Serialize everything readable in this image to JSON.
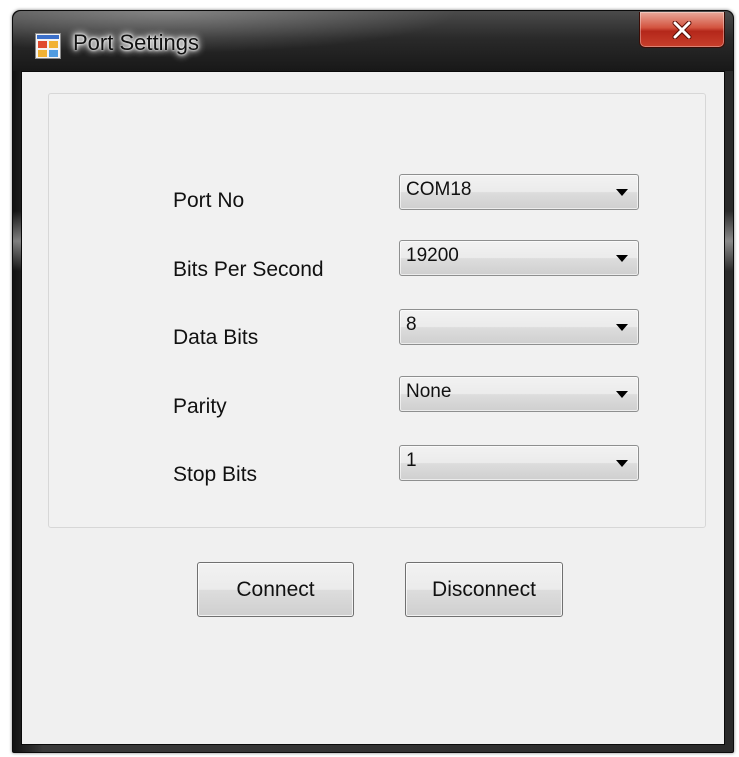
{
  "window": {
    "title": "Port Settings",
    "close_icon": "close-x-icon",
    "app_icon": "application-icon"
  },
  "form": {
    "fields": [
      {
        "label": "Port No",
        "value": "COM18"
      },
      {
        "label": "Bits Per Second",
        "value": "19200"
      },
      {
        "label": "Data Bits",
        "value": "8"
      },
      {
        "label": "Parity",
        "value": "None"
      },
      {
        "label": "Stop Bits",
        "value": "1"
      }
    ]
  },
  "buttons": {
    "connect_label": "Connect",
    "disconnect_label": "Disconnect"
  },
  "colors": {
    "close_button": "#c8402c",
    "client_background": "#f0f0f0"
  }
}
